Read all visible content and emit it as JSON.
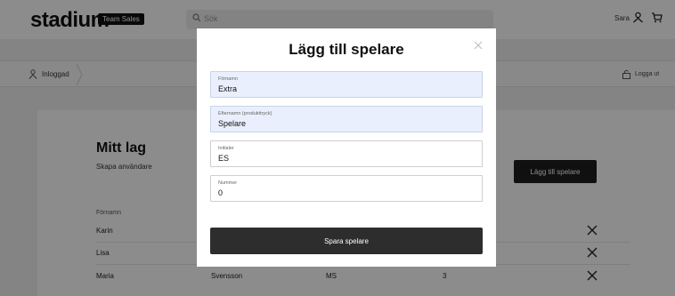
{
  "header": {
    "logo_text": "stadium",
    "logo_badge": "Team Sales",
    "search_placeholder": "Sök",
    "user_name": "Sara",
    "icons": [
      "search-icon",
      "user-icon",
      "cart-icon"
    ]
  },
  "breadcrumb": {
    "label": "Inloggad",
    "logout_label": "Logga ut"
  },
  "team": {
    "title": "Mitt lag",
    "subtitle": "Skapa användare",
    "add_button": "Lägg till spelare",
    "column_header": "Förnamn",
    "rows": [
      {
        "first": "Karin",
        "last": "",
        "initials": "",
        "number": ""
      },
      {
        "first": "Lisa",
        "last": "",
        "initials": "",
        "number": ""
      },
      {
        "first": "Maria",
        "last": "Svensson",
        "initials": "MS",
        "number": "3"
      }
    ]
  },
  "modal": {
    "title": "Lägg till spelare",
    "fields": [
      {
        "label": "Förnamn",
        "value": "Extra"
      },
      {
        "label": "Efternamn (produkttryck)",
        "value": "Spelare"
      },
      {
        "label": "Initialer",
        "value": "ES"
      },
      {
        "label": "Nummer",
        "value": "0"
      }
    ],
    "save_button": "Spara spelare"
  },
  "colors": {
    "overlay": "#000000",
    "filled_field": "#e9effc",
    "button_dark": "#2d2d2d"
  }
}
